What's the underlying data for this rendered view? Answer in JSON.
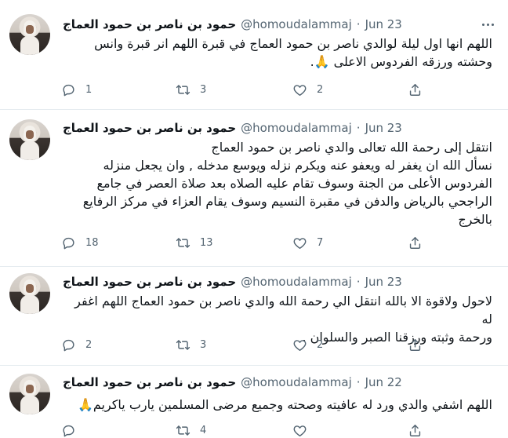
{
  "tweets": [
    {
      "name": "حمود بن ناصر بن حمود العماج",
      "handle": "@homoudalammaj",
      "dot": "·",
      "date": "Jun 23",
      "lines": [
        "اللهم انها اول ليلة لوالدي ناصر بن حمود العماج في قبرة اللهم انر قبرة وانس",
        "وحشته ورزقه الفردوس الاعلى 🙏."
      ],
      "replies": "1",
      "retweets": "3",
      "likes": "2"
    },
    {
      "name": "حمود بن ناصر بن حمود العماج",
      "handle": "@homoudalammaj",
      "dot": "·",
      "date": "Jun 23",
      "lines": [
        "انتقل إلى رحمة الله تعالى  والدي ناصر بن حمود العماج",
        "نسأل الله ان يغفر له ويعفو عنه ويكرم نزله ويوسع مدخله , وان يجعل منزله",
        "الفردوس الأعلى من الجنة وسوف تقام عليه الصلاه بعد صلاة العصر في جامع",
        "الراجحي بالرياض والدفن في مقبرة النسيم وسوف يقام العزاء في مركز الرفايع",
        "بالخرج"
      ],
      "replies": "18",
      "retweets": "13",
      "likes": "7"
    },
    {
      "name": "حمود بن ناصر بن حمود العماج",
      "handle": "@homoudalammaj",
      "dot": "·",
      "date": "Jun 23",
      "lines": [
        "لاحول ولاقوة الا بالله انتقل الي رحمة الله والدي ناصر بن حمود العماج اللهم اغفر له",
        "ورحمة وثبته ورزقنا الصبر والسلوان ."
      ],
      "replies": "2",
      "retweets": "3",
      "likes": "2"
    },
    {
      "name": "حمود بن ناصر بن حمود العماج",
      "handle": "@homoudalammaj",
      "dot": "·",
      "date": "Jun 22",
      "lines": [
        "اللهم اشفي والدي ورد له عافيته وصحته وجميع مرضى المسلمين يارب ياكريم🙏"
      ],
      "replies": "",
      "retweets": "4",
      "likes": "",
      "partial": true
    }
  ],
  "icons": {
    "reply": "reply-icon",
    "retweet": "retweet-icon",
    "like": "heart-icon",
    "share": "share-icon",
    "more": "more-icon"
  },
  "colors": {
    "text": "#0f1419",
    "secondary": "#536471",
    "divider": "#e6ecf0",
    "background": "#ffffff"
  }
}
